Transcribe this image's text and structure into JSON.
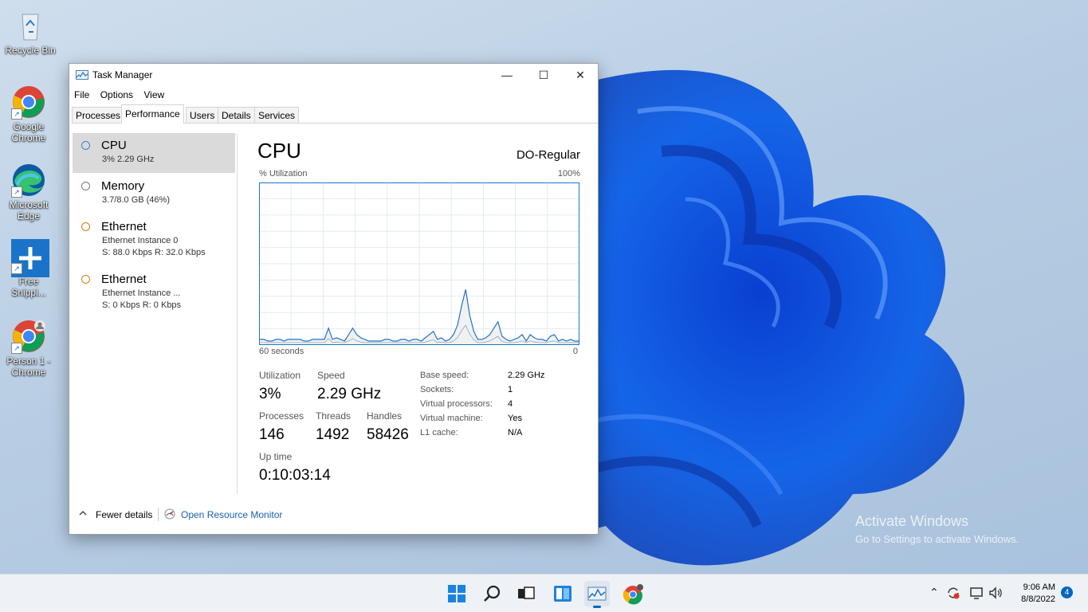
{
  "desktop": {
    "icons": [
      {
        "label": "Recycle Bin"
      },
      {
        "label": "Google Chrome"
      },
      {
        "label": "Microsoft Edge"
      },
      {
        "label": "Free Snippi..."
      },
      {
        "label": "Person 1 - Chrome"
      }
    ],
    "watermark": {
      "title": "Activate Windows",
      "subtitle": "Go to Settings to activate Windows."
    }
  },
  "window": {
    "title": "Task Manager",
    "controls": {
      "minimize": "—",
      "maximize": "☐",
      "close": "✕"
    },
    "menu": [
      "File",
      "Options",
      "View"
    ],
    "tabs": [
      "Processes",
      "Performance",
      "Users",
      "Details",
      "Services"
    ],
    "active_tab": "Performance",
    "resources": [
      {
        "name": "CPU",
        "line1": "3% 2.29 GHz",
        "line2": "",
        "selected": true
      },
      {
        "name": "Memory",
        "line1": "3.7/8.0 GB (46%)",
        "line2": "",
        "selected": false
      },
      {
        "name": "Ethernet",
        "line1": "Ethernet Instance 0",
        "line2": "S: 88.0 Kbps  R: 32.0 Kbps",
        "selected": false
      },
      {
        "name": "Ethernet",
        "line1": "Ethernet Instance ...",
        "line2": "S: 0 Kbps  R: 0 Kbps",
        "selected": false
      }
    ],
    "cpu": {
      "title": "CPU",
      "model": "DO-Regular",
      "graph_label_left": "% Utilization",
      "graph_label_right": "100%",
      "time_left": "60 seconds",
      "time_right": "0",
      "graph_color": "#1e74c8",
      "utilization_series": [
        3,
        3,
        2,
        2,
        3,
        3,
        2,
        3,
        3,
        3,
        3,
        2,
        2,
        3,
        3,
        3,
        3,
        10,
        3,
        4,
        3,
        2,
        6,
        10,
        6,
        4,
        3,
        2,
        2,
        2,
        2,
        3,
        3,
        2,
        2,
        3,
        3,
        2,
        3,
        3,
        2,
        4,
        6,
        8,
        3,
        4,
        2,
        3,
        6,
        12,
        24,
        34,
        18,
        8,
        3,
        3,
        4,
        6,
        10,
        14,
        5,
        3,
        2,
        3,
        4,
        6,
        2,
        6,
        4,
        3,
        3,
        2,
        5,
        6,
        2,
        3,
        2,
        3,
        2,
        2
      ],
      "stats": {
        "utilization_label": "Utilization",
        "utilization": "3%",
        "speed_label": "Speed",
        "speed": "2.29 GHz",
        "processes_label": "Processes",
        "processes": "146",
        "threads_label": "Threads",
        "threads": "1492",
        "handles_label": "Handles",
        "handles": "58426",
        "uptime_label": "Up time",
        "uptime": "0:10:03:14"
      },
      "details": [
        {
          "key": "Base speed:",
          "value": "2.29 GHz"
        },
        {
          "key": "Sockets:",
          "value": "1"
        },
        {
          "key": "Virtual processors:",
          "value": "4"
        },
        {
          "key": "Virtual machine:",
          "value": "Yes"
        },
        {
          "key": "L1 cache:",
          "value": "N/A"
        }
      ]
    },
    "footer": {
      "fewer_details": "Fewer details",
      "open_resource_monitor": "Open Resource Monitor"
    }
  },
  "taskbar": {
    "apps": [
      "start-icon",
      "search-icon",
      "task-view-icon",
      "widgets-icon",
      "task-manager-icon",
      "chrome-icon"
    ],
    "time": "9:06 AM",
    "date": "8/8/2022",
    "notifications": "4"
  }
}
